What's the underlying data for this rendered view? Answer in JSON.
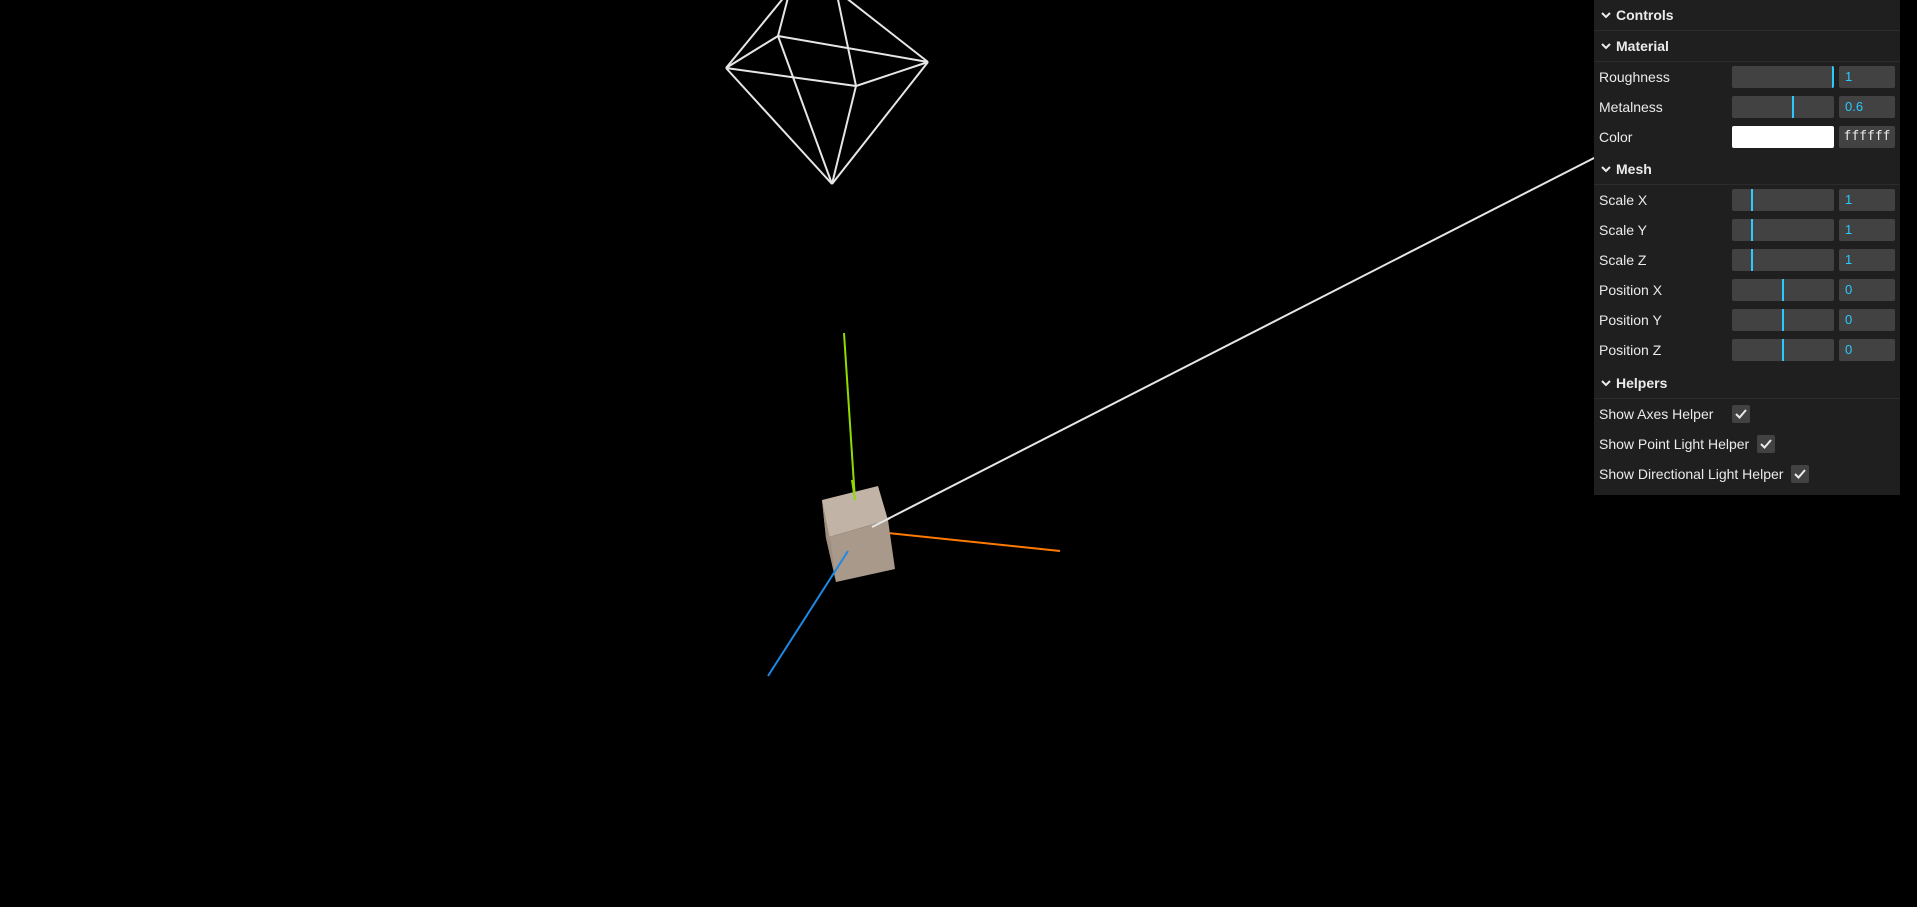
{
  "panel": {
    "title": "Controls",
    "material": {
      "title": "Material",
      "roughness": {
        "label": "Roughness",
        "value": "1",
        "fraction": 1.0
      },
      "metalness": {
        "label": "Metalness",
        "value": "0.6",
        "fraction": 0.6
      },
      "color": {
        "label": "Color",
        "value": "ffffff",
        "swatch": "#ffffff"
      }
    },
    "mesh": {
      "title": "Mesh",
      "scale_x": {
        "label": "Scale X",
        "value": "1"
      },
      "scale_y": {
        "label": "Scale Y",
        "value": "1"
      },
      "scale_z": {
        "label": "Scale Z",
        "value": "1"
      },
      "position_x": {
        "label": "Position X",
        "value": "0"
      },
      "position_y": {
        "label": "Position Y",
        "value": "0"
      },
      "position_z": {
        "label": "Position Z",
        "value": "0"
      }
    },
    "helpers": {
      "title": "Helpers",
      "show_axes": {
        "label": "Show Axes Helper",
        "checked": true
      },
      "show_point_light": {
        "label": "Show Point Light Helper",
        "checked": true
      },
      "show_directional_light": {
        "label": "Show Directional Light Helper",
        "checked": true
      }
    }
  },
  "colors": {
    "panel_bg": "#1f1f1f",
    "accent": "#2cc9ff",
    "axis_x": "#ff7a00",
    "axis_y": "#8fdc00",
    "axis_z": "#1e88e5",
    "cube": "#b8a99b",
    "helper_lines": "#e6e6e6"
  },
  "icons": {
    "chevron": "chevron-down-icon",
    "check": "check-icon"
  }
}
